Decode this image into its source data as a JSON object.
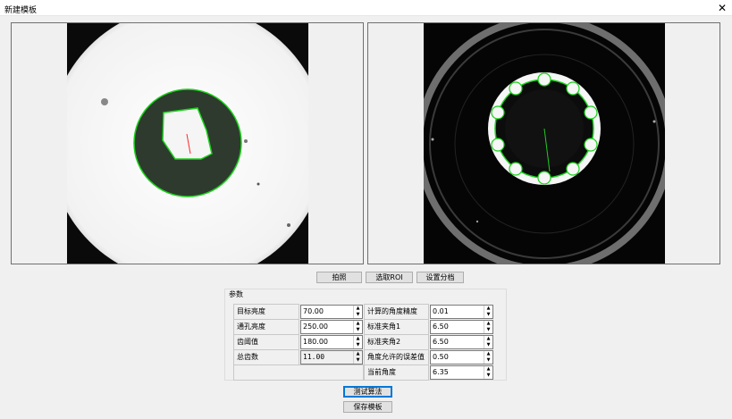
{
  "window": {
    "title": "新建模板",
    "close": "✕"
  },
  "buttons": {
    "capture": "拍照",
    "select_roi": "选取ROI",
    "set_tooth": "设置分档",
    "test": "测试算法",
    "save": "保存模板"
  },
  "params": {
    "group_title": "参数",
    "left": [
      {
        "label": "目标亮度",
        "value": "70.00"
      },
      {
        "label": "通孔亮度",
        "value": "250.00"
      },
      {
        "label": "齿阈值",
        "value": "180.00"
      },
      {
        "label": "总齿数",
        "value": "11.00"
      }
    ],
    "right": [
      {
        "label": "计算的角度精度",
        "value": "0.01"
      },
      {
        "label": "标准夹角1",
        "value": "6.50"
      },
      {
        "label": "标准夹角2",
        "value": "6.50"
      },
      {
        "label": "角度允许的误差值",
        "value": "0.50"
      },
      {
        "label": "当前角度",
        "value": "6.35"
      }
    ]
  },
  "icons": {
    "up": "▲",
    "down": "▼"
  },
  "colors": {
    "contour": "#1bd11b",
    "red_line": "#ff2a2a",
    "green_line": "#22cc22"
  }
}
